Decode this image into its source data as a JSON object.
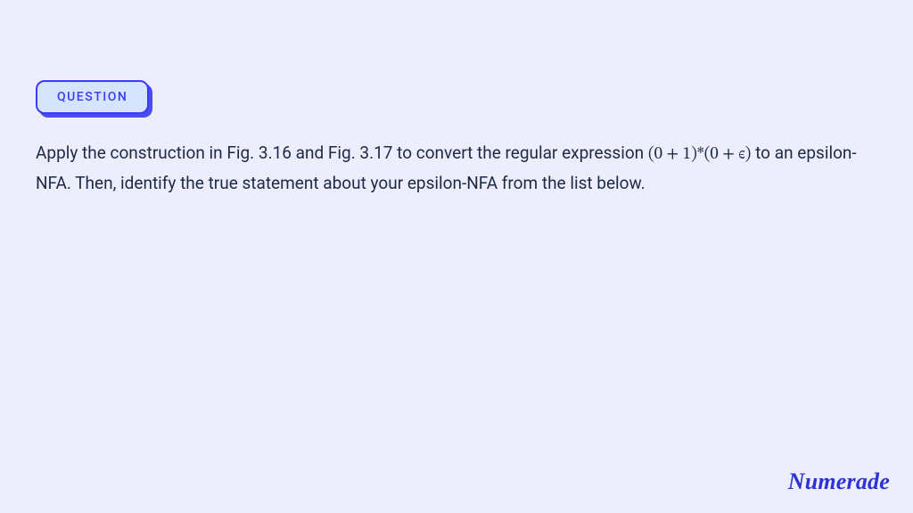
{
  "badge": {
    "label": "QUESTION"
  },
  "question": {
    "part1": "Apply the construction in Fig. 3.16 and Fig. 3.17 to convert the regular expression ",
    "expression": "(0 + 1)*(0 + ϵ)",
    "part2": " to an epsilon-NFA. Then, identify the true statement about your epsilon-NFA from the list below."
  },
  "brand": {
    "name": "Numerade"
  }
}
